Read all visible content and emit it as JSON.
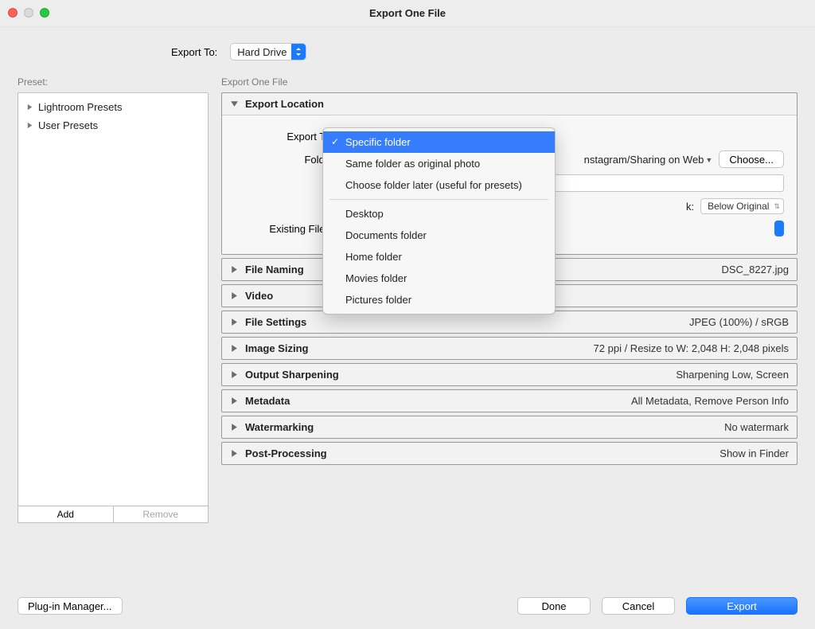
{
  "window": {
    "title": "Export One File"
  },
  "export_to": {
    "label": "Export To:",
    "value": "Hard Drive"
  },
  "preset": {
    "label": "Preset:",
    "items": [
      {
        "label": "Lightroom Presets"
      },
      {
        "label": "User Presets"
      }
    ],
    "add_label": "Add",
    "remove_label": "Remove"
  },
  "right_header": "Export One File",
  "export_location": {
    "title": "Export Location",
    "export_to_label": "Export To",
    "folder_label": "Folde",
    "path_fragment": "nstagram/Sharing on Web",
    "choose_label": "Choose...",
    "stack_label": "k:",
    "stack_value": "Below Original",
    "existing_files_label": "Existing Files",
    "dropdown": {
      "items": [
        "Specific folder",
        "Same folder as original photo",
        "Choose folder later (useful for presets)"
      ],
      "recent": [
        "Desktop",
        "Documents folder",
        "Home folder",
        "Movies folder",
        "Pictures folder"
      ],
      "selected_index": 0
    }
  },
  "panels": [
    {
      "title": "File Naming",
      "summary": "DSC_8227.jpg"
    },
    {
      "title": "Video",
      "summary": ""
    },
    {
      "title": "File Settings",
      "summary": "JPEG (100%) / sRGB"
    },
    {
      "title": "Image Sizing",
      "summary": "72 ppi / Resize to W: 2,048 H: 2,048 pixels"
    },
    {
      "title": "Output Sharpening",
      "summary": "Sharpening Low, Screen"
    },
    {
      "title": "Metadata",
      "summary": "All Metadata, Remove Person Info"
    },
    {
      "title": "Watermarking",
      "summary": "No watermark"
    },
    {
      "title": "Post-Processing",
      "summary": "Show in Finder"
    }
  ],
  "footer": {
    "plugin_label": "Plug-in Manager...",
    "done_label": "Done",
    "cancel_label": "Cancel",
    "export_label": "Export"
  }
}
